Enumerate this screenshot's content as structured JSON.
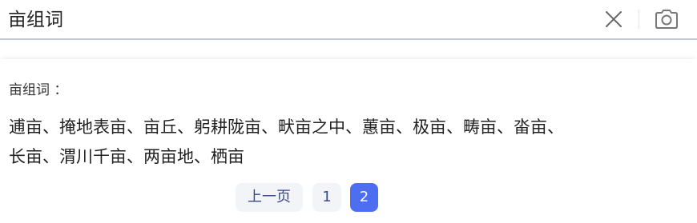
{
  "search": {
    "query": "亩组词"
  },
  "result": {
    "title": "亩组词 ：",
    "lines": [
      "逋亩、掩地表亩、亩丘、躬耕陇亩、畎亩之中、蕙亩、极亩、畴亩、畓亩、",
      "长亩、渭川千亩、两亩地、栖亩"
    ]
  },
  "pagination": {
    "prev_label": "上一页",
    "pages": [
      "1",
      "2"
    ],
    "current_page": "2"
  },
  "colors": {
    "accent": "#4e6ef2",
    "pager_bg": "#f3f4f8",
    "pager_text": "#3a4a8a"
  },
  "icons": {
    "clear": "close-icon",
    "camera": "camera-icon"
  }
}
